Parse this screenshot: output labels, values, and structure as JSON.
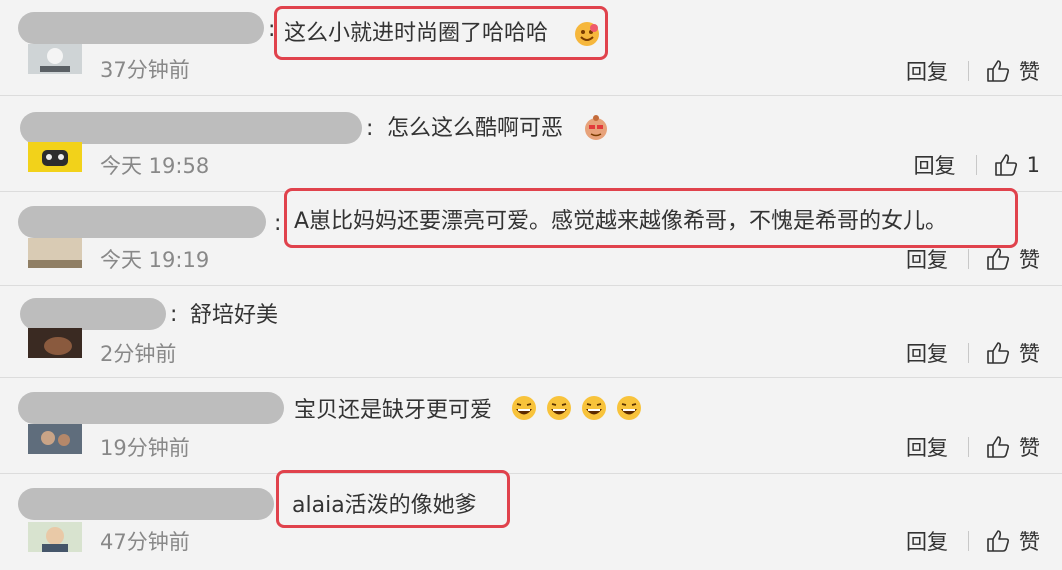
{
  "comments": [
    {
      "text": "这么小就进时尚圈了哈哈哈",
      "time": "37分钟前",
      "reply": "回复",
      "like": "赞"
    },
    {
      "text": "怎么这么酷啊可恶",
      "time": "今天 19:58",
      "reply": "回复",
      "like": "1"
    },
    {
      "text": "A崽比妈妈还要漂亮可爱。感觉越来越像希哥，不愧是希哥的女儿。",
      "time": "今天 19:19",
      "reply": "回复",
      "like": "赞"
    },
    {
      "text": "舒培好美",
      "time": "2分钟前",
      "reply": "回复",
      "like": "赞"
    },
    {
      "text": "宝贝还是缺牙更可爱",
      "time": "19分钟前",
      "reply": "回复",
      "like": "赞"
    },
    {
      "text": "alaia活泼的像她爹",
      "time": "47分钟前",
      "reply": "回复",
      "like": "赞"
    }
  ],
  "colors": {
    "highlight": "#e0424c",
    "background": "#f3f3f3",
    "timestamp": "#888888"
  },
  "icons": {
    "like": "thumbs-up-icon",
    "emoji": "smiley-emoji"
  }
}
